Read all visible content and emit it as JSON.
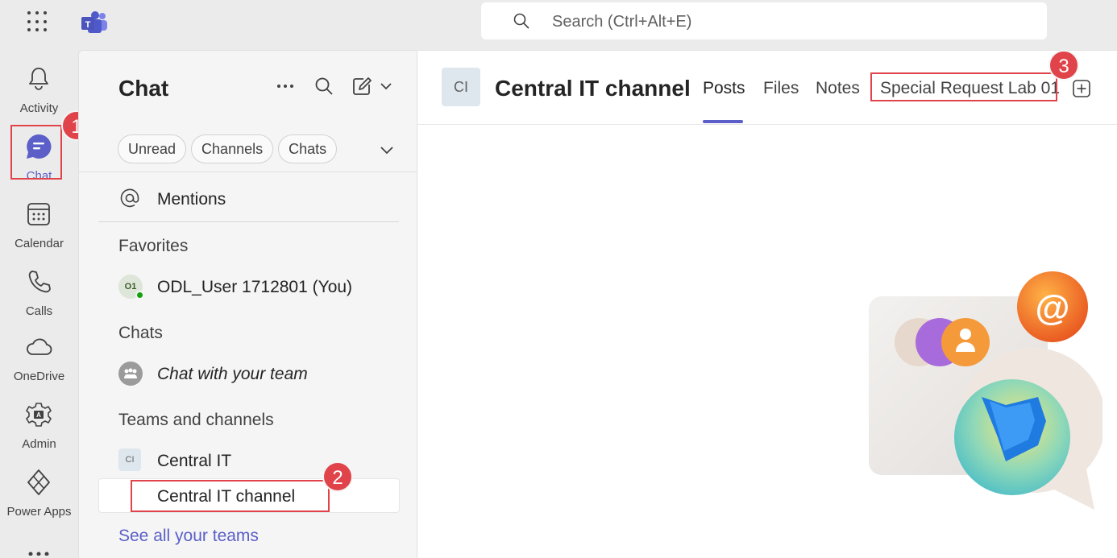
{
  "search": {
    "placeholder": "Search (Ctrl+Alt+E)"
  },
  "rail": {
    "items": [
      {
        "label": "Activity",
        "icon": "bell-icon"
      },
      {
        "label": "Chat",
        "icon": "chat-icon"
      },
      {
        "label": "Calendar",
        "icon": "calendar-icon"
      },
      {
        "label": "Calls",
        "icon": "phone-icon"
      },
      {
        "label": "OneDrive",
        "icon": "cloud-icon"
      },
      {
        "label": "Admin",
        "icon": "admin-gear-icon"
      },
      {
        "label": "Power Apps",
        "icon": "power-apps-icon"
      }
    ]
  },
  "chatpane": {
    "title": "Chat",
    "filters": [
      "Unread",
      "Channels",
      "Chats"
    ],
    "mentions": "Mentions",
    "sections": {
      "favorites": "Favorites",
      "chats": "Chats",
      "teams": "Teams and channels"
    },
    "favorite_user": {
      "name": "ODL_User 1712801 (You)",
      "initials": "O1"
    },
    "chat_with_team": "Chat with your team",
    "team": {
      "name": "Central IT",
      "initials": "CI"
    },
    "channel": "Central IT channel",
    "see_all": "See all your teams"
  },
  "main": {
    "avatar": "CI",
    "title": "Central IT channel",
    "tabs": [
      "Posts",
      "Files",
      "Notes",
      "Special Request Lab 01"
    ],
    "active_tab": "Posts"
  },
  "badges": [
    "1",
    "2",
    "3"
  ],
  "colors": {
    "accent": "#5b5fc7",
    "highlight": "#e0434a",
    "online": "#13a10e"
  }
}
